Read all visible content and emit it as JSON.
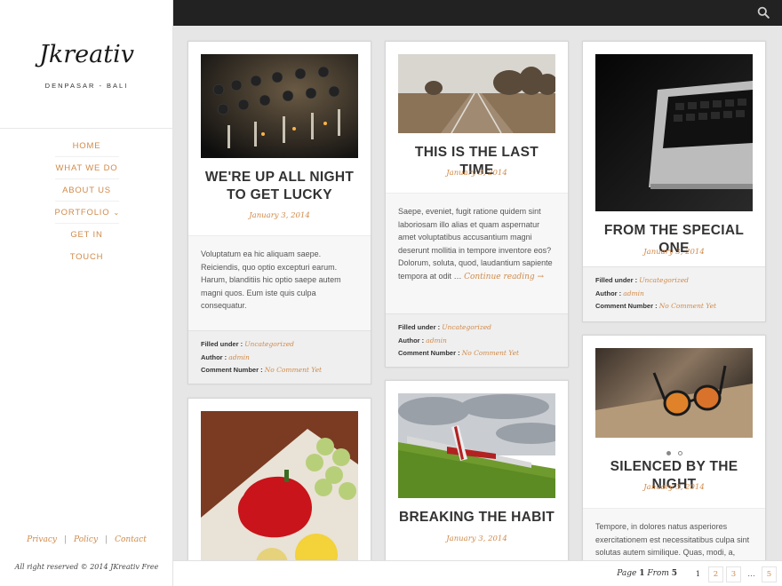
{
  "site": {
    "title": "Jkreativ",
    "tagline": "DENPASAR - BALI"
  },
  "nav": [
    {
      "label": "HOME"
    },
    {
      "label": "WHAT WE DO"
    },
    {
      "label": "ABOUT US"
    },
    {
      "label": "PORTFOLIO",
      "has_dropdown": true
    },
    {
      "label": "GET IN TOUCH"
    }
  ],
  "footer": {
    "links": [
      "Privacy",
      "Policy",
      "Contact"
    ],
    "separator": "|",
    "copyright": "All right reserved © 2014 JKreativ Free"
  },
  "meta_labels": {
    "filled": "Filled under :",
    "author": "Author :",
    "comments": "Comment Number :"
  },
  "posts": [
    {
      "title": "WE'RE UP ALL NIGHT TO GET LUCKY",
      "date": "January 3, 2014",
      "excerpt": "Voluptatum ea hic aliquam saepe. Reiciendis, quo optio excepturi earum. Harum, blanditiis hic optio saepe autem magni quos. Eum iste quis culpa consequatur.",
      "category": "Uncategorized",
      "author": "admin",
      "comments": "No Comment Yet",
      "image": "audio-mixer-image"
    },
    {
      "title": "THIS IS THE LAST TIME",
      "date": "January 3, 2014",
      "excerpt": "Saepe, eveniet, fugit ratione quidem sint laboriosam illo alias et quam aspernatur amet voluptatibus accusantium magni deserunt mollitia in tempore inventore eos? Dolorum, soluta, quod, laudantium sapiente tempora at odit …",
      "read_more": "Continue reading →",
      "category": "Uncategorized",
      "author": "admin",
      "comments": "No Comment Yet",
      "image": "railway-tracks-image"
    },
    {
      "title": "FROM THE SPECIAL ONE",
      "date": "January 3, 2014",
      "category": "Uncategorized",
      "author": "admin",
      "comments": "No Comment Yet",
      "image": "laptop-keyboard-image"
    },
    {
      "title": "",
      "image": "vegetables-image"
    },
    {
      "title": "BREAKING THE HABIT",
      "date": "January 3, 2014",
      "image": "airplane-field-image"
    },
    {
      "title": "SILENCED BY THE NIGHT",
      "date": "January 3, 2014",
      "excerpt": "Tempore, in dolores natus asperiores exercitationem est necessitatibus culpa sint solutas autem similique. Quas, modi, a,",
      "image": "sunglasses-image",
      "slider": {
        "slides": 2,
        "active": 1
      }
    }
  ],
  "pagination": {
    "label_prefix": "Page",
    "current": "1",
    "label_mid": "From",
    "total": "5",
    "pages": [
      "1",
      "2",
      "3",
      "…",
      "5"
    ]
  },
  "colors": {
    "accent": "#d08a4a",
    "topbar": "#222222",
    "background": "#e6e6e6"
  }
}
